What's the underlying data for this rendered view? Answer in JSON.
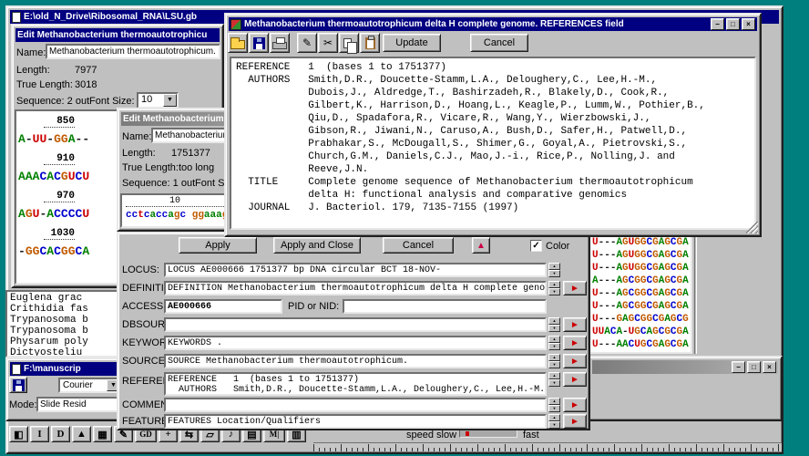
{
  "icons": {
    "minimize": "−",
    "maximize": "□",
    "close": "×",
    "dropdown": "▼",
    "spin_up": "▲",
    "spin_down": "▼",
    "red_arrow": "►",
    "up_arrow": "▲",
    "check": "✓",
    "pencil": "✎",
    "scissors": "✂"
  },
  "colors": {
    "desktop": "#007f7f",
    "title_active": "#000080",
    "title_inactive": "#8a8a8a",
    "window_face": "#c0c0c0",
    "field_arrow": "#cc0000"
  },
  "base_colors": {
    "A": "#008000",
    "C": "#0000cc",
    "G": "#c05a00",
    "U": "#cc0000",
    "T": "#cc0000",
    "-": "#1a1a1a"
  },
  "back_window": {
    "title": "E:\\old_N_Drive\\Ribosomal_RNA\\LSU.gb"
  },
  "edit1": {
    "title": "Edit Methanobacterium thermoautotrophicu",
    "name_label": "Name:",
    "name_value": "Methanobacterium thermoautotrophicum.",
    "length_label": "Length:",
    "length_value": "7977",
    "true_length_label": "True Length:",
    "true_length_value": "3018",
    "sequence_label": "Sequence: 2 out",
    "font_size_label": "Font Size:",
    "font_size_value": "10",
    "ruler_rows": [
      {
        "pos": "850",
        "seq": "A-UU-GGA--"
      },
      {
        "pos": "910",
        "seq": "AAACACGUCU"
      },
      {
        "pos": "970",
        "seq": "AGU-ACCCCU"
      },
      {
        "pos": "1030",
        "seq": "-GGCACGGCA"
      }
    ]
  },
  "edit2": {
    "title": "Edit Methanobacterium",
    "name_label": "Name:",
    "name_value": "Methanobacterium th",
    "length_label": "Length:",
    "length_value": "1751377",
    "true_length_label": "True Length:",
    "true_length_value": "too long",
    "sequence_label": "Sequence: 1 out",
    "font_size_label": "Font Size:",
    "ruler_display": "        10",
    "sequence": "cctcaccagc ggaaag"
  },
  "references_window": {
    "title": "Methanobacterium thermoautotrophicum delta H complete genome. REFERENCES field",
    "update_label": "Update",
    "cancel_label": "Cancel",
    "text": "REFERENCE   1  (bases 1 to 1751377)\n  AUTHORS   Smith,D.R., Doucette-Stamm,L.A., Deloughery,C., Lee,H.-M.,\n            Dubois,J., Aldredge,T., Bashirzadeh,R., Blakely,D., Cook,R.,\n            Gilbert,K., Harrison,D., Hoang,L., Keagle,P., Lumm,W., Pothier,B.,\n            Qiu,D., Spadafora,R., Vicare,R., Wang,Y., Wierzbowski,J.,\n            Gibson,R., Jiwani,N., Caruso,A., Bush,D., Safer,H., Patwell,D.,\n            Prabhakar,S., McDougall,S., Shimer,G., Goyal,A., Pietrovski,S.,\n            Church,G.M., Daniels,C.J., Mao,J.-i., Rice,P., Nolling,J. and\n            Reeve,J.N.\n  TITLE     Complete genome sequence of Methanobacterium thermoautotrophicum\n            delta H: functional analysis and comparative genomics\n  JOURNAL   J. Bacteriol. 179, 7135-7155 (1997)"
  },
  "genbank": {
    "apply_label": "Apply",
    "apply_close_label": "Apply and Close",
    "cancel_label": "Cancel",
    "color_label": "Color",
    "rows": [
      {
        "label": "LOCUS:",
        "value": "LOCUS      AE000666  1751377 bp   DNA   circular  BCT    18-NOV-"
      },
      {
        "label": "DEFINITION:",
        "value": "DEFINITION  Methanobacterium thermoautotrophicum delta H complete genome."
      },
      {
        "label": "ACCESSION:",
        "value": "AE000666",
        "pid_label": "PID or NID:",
        "pid_value": ""
      },
      {
        "label": "DBSOURCE:",
        "value": ""
      },
      {
        "label": "KEYWORDS:",
        "value": "KEYWORDS    ."
      },
      {
        "label": "SOURCE:",
        "value": "SOURCE      Methanobacterium thermoautotrophicum."
      },
      {
        "label": "REFERENCES:",
        "value": "REFERENCE   1  (bases 1 to 1751377)",
        "value2": "  AUTHORS   Smith,D.R., Doucette-Stamm,L.A., Deloughery,C., Lee,H.-M.,"
      },
      {
        "label": "COMMENT:",
        "value": ""
      },
      {
        "label": "FEATURES:",
        "value": "FEATURES             Location/Qualifiers"
      }
    ]
  },
  "species_list": {
    "items": [
      "Euglena grac",
      "Crithidia fas",
      "Trypanosoma b",
      "Trypanosoma b",
      "Physarum poly",
      "Dictyosteliu"
    ]
  },
  "manuscript": {
    "title": "F:\\manuscrip",
    "font_name": "Courier",
    "mode_label": "Mode:",
    "mode_value": "Slide Resid"
  },
  "alignment": {
    "rows": [
      "U---AGUGGCGAGCGA",
      "U---AGUGGCGAGCGA",
      "U---AGUGGCGAGCGA",
      "A---AGCGGCGAGCGA",
      "U---AGCGGCGAGCGA",
      "U---AGCGGCGAGCGA",
      "U---GAGCGGCGAGCG",
      "UUACA-UGCAGCGCGA",
      "U---AACUGCGAGCGA"
    ]
  },
  "bottom": {
    "buttons": [
      {
        "name": "layout",
        "glyph": "◧"
      },
      {
        "name": "insert",
        "glyph": "I"
      },
      {
        "name": "delete",
        "glyph": "D"
      },
      {
        "name": "caret-up",
        "glyph": "▲"
      },
      {
        "name": "grid",
        "glyph": "▦"
      },
      {
        "name": "pencil",
        "glyph": "✎"
      },
      {
        "name": "gd",
        "glyph": "GD"
      },
      {
        "name": "plus",
        "glyph": "+"
      },
      {
        "name": "swap",
        "glyph": "⇆"
      },
      {
        "name": "shape",
        "glyph": "▱"
      },
      {
        "name": "note",
        "glyph": "♪"
      },
      {
        "name": "rows",
        "glyph": "▤"
      },
      {
        "name": "mi",
        "glyph": "M|"
      },
      {
        "name": "cols",
        "glyph": "▥"
      }
    ],
    "speed_label": "speed slow",
    "fast_label": "fast"
  }
}
